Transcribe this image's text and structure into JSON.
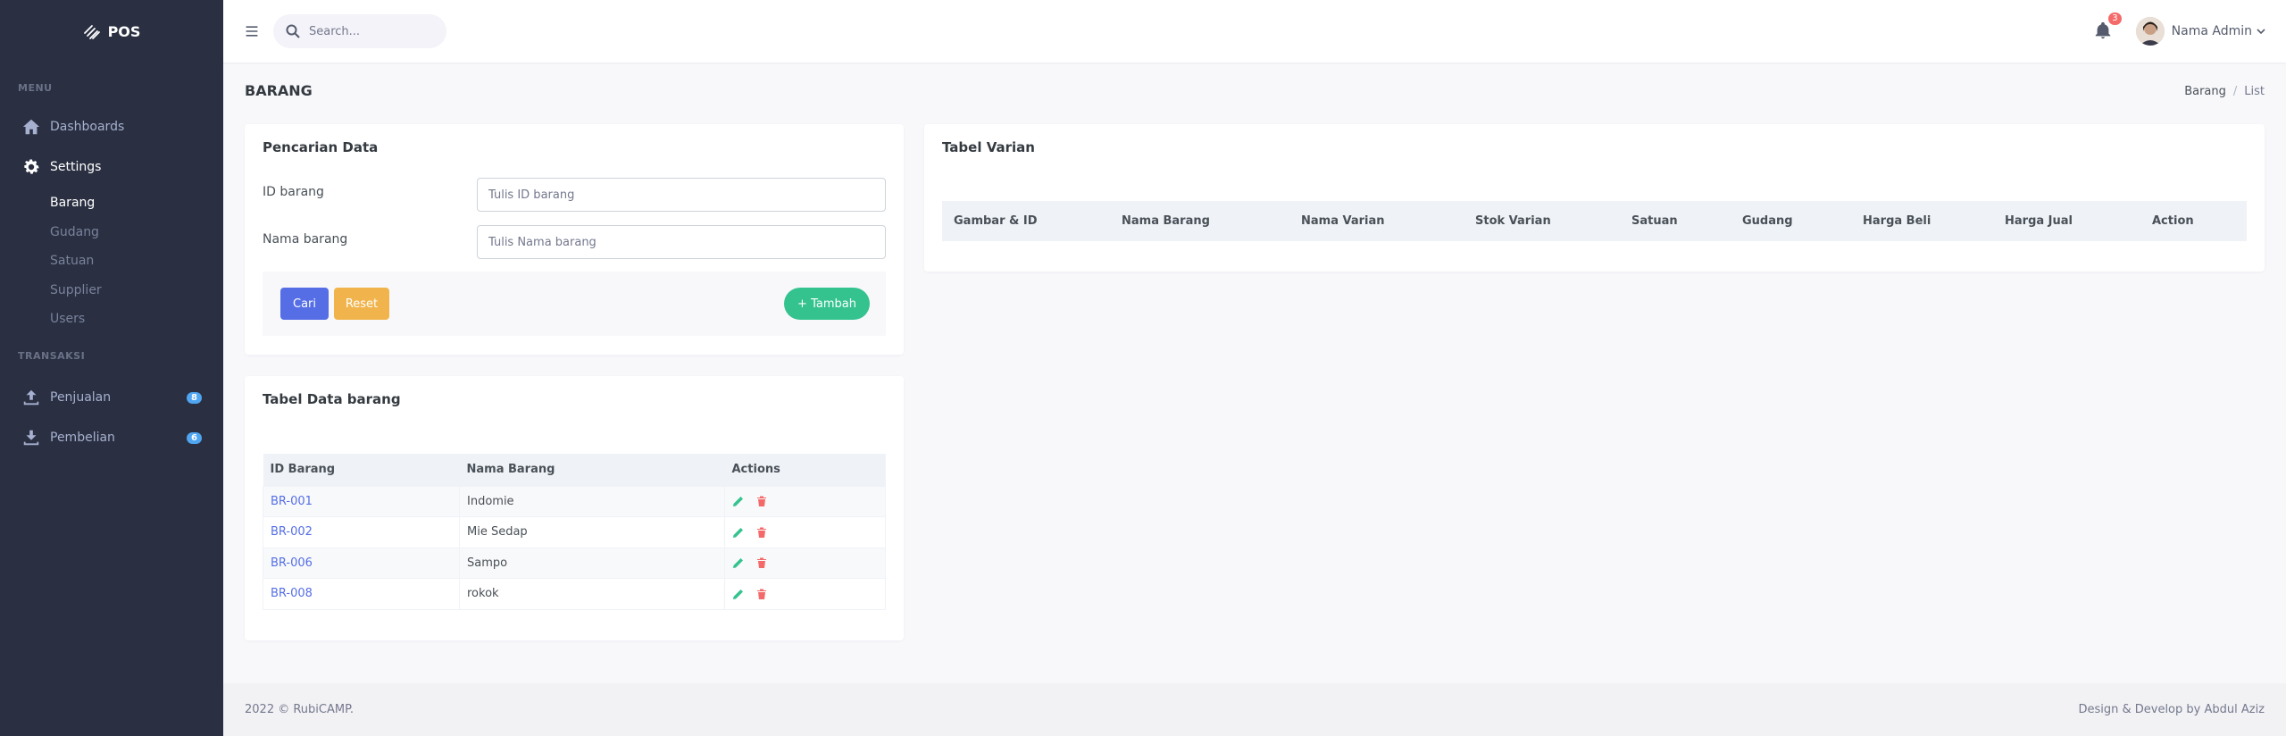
{
  "brand": {
    "name": "POS"
  },
  "sidebar": {
    "menu_title": "MENU",
    "transaksi_title": "TRANSAKSI",
    "items": [
      {
        "label": "Dashboards",
        "icon": "home-icon"
      },
      {
        "label": "Settings",
        "icon": "gear-icon"
      }
    ],
    "settings_sub": [
      "Barang",
      "Gudang",
      "Satuan",
      "Supplier",
      "Users"
    ],
    "transaksi": [
      {
        "label": "Penjualan",
        "badge": "8",
        "icon": "upload-icon"
      },
      {
        "label": "Pembelian",
        "badge": "6",
        "icon": "download-icon"
      }
    ]
  },
  "topbar": {
    "search_placeholder": "Search...",
    "notification_count": "3",
    "user_name": "Nama Admin"
  },
  "page": {
    "title": "BARANG",
    "breadcrumb": [
      "Barang",
      "List"
    ]
  },
  "search_card": {
    "title": "Pencarian Data",
    "id_label": "ID barang",
    "id_placeholder": "Tulis ID barang",
    "name_label": "Nama barang",
    "name_placeholder": "Tulis Nama barang",
    "btn_cari": "Cari",
    "btn_reset": "Reset",
    "btn_tambah": "+ Tambah"
  },
  "data_table": {
    "title": "Tabel Data barang",
    "columns": [
      "ID Barang",
      "Nama Barang",
      "Actions"
    ],
    "rows": [
      {
        "id": "BR-001",
        "name": "Indomie"
      },
      {
        "id": "BR-002",
        "name": "Mie Sedap"
      },
      {
        "id": "BR-006",
        "name": "Sampo"
      },
      {
        "id": "BR-008",
        "name": "rokok"
      }
    ]
  },
  "variant_table": {
    "title": "Tabel Varian",
    "columns": [
      "Gambar & ID",
      "Nama Barang",
      "Nama Varian",
      "Stok Varian",
      "Satuan",
      "Gudang",
      "Harga Beli",
      "Harga Jual",
      "Action"
    ]
  },
  "footer": {
    "left": "2022 © RubiCAMP.",
    "right": "Design & Develop by Abdul Aziz"
  },
  "colors": {
    "sidebar_bg": "#2a3042",
    "primary": "#556ee6",
    "warning": "#f1b44c",
    "success": "#34c38f",
    "danger": "#f46a6a",
    "info": "#50a5f1"
  }
}
